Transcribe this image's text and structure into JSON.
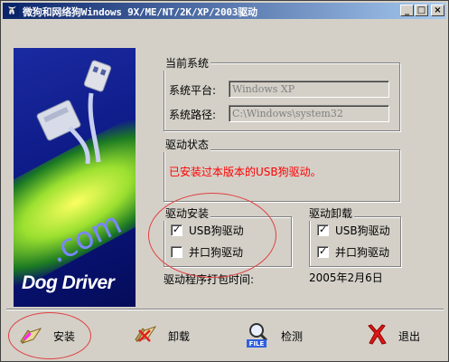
{
  "window": {
    "title": "微狗和网络狗Windows 9X/ME/NT/2K/XP/2003驱动",
    "controls": {
      "minimize": "_",
      "maximize": "□",
      "close": "×"
    }
  },
  "banner": {
    "com_text": ".com",
    "brand_text": "Dog Driver"
  },
  "current_system": {
    "title": "当前系统",
    "platform_label": "系统平台:",
    "platform_value": "Windows XP",
    "path_label": "系统路径:",
    "path_value": "C:\\Windows\\system32"
  },
  "driver_status": {
    "title": "驱动状态",
    "message": "已安装过本版本的USB狗驱动。",
    "message_color": "#ff0000"
  },
  "driver_install": {
    "title": "驱动安装",
    "options": [
      {
        "label": "USB狗驱动",
        "checked": true
      },
      {
        "label": "并口狗驱动",
        "checked": false
      }
    ]
  },
  "driver_uninstall": {
    "title": "驱动卸载",
    "options": [
      {
        "label": "USB狗驱动",
        "checked": true
      },
      {
        "label": "并口狗驱动",
        "checked": true
      }
    ]
  },
  "package_time": {
    "label": "驱动程序打包时间:",
    "value": "2005年2月6日"
  },
  "buttons": {
    "install": "安装",
    "uninstall": "卸载",
    "detect": "检测",
    "exit": "退出",
    "detect_icon_text": "FILE"
  },
  "colors": {
    "titlebar_start": "#0a246a",
    "titlebar_end": "#a6caf0",
    "annotation": "#e04040"
  }
}
